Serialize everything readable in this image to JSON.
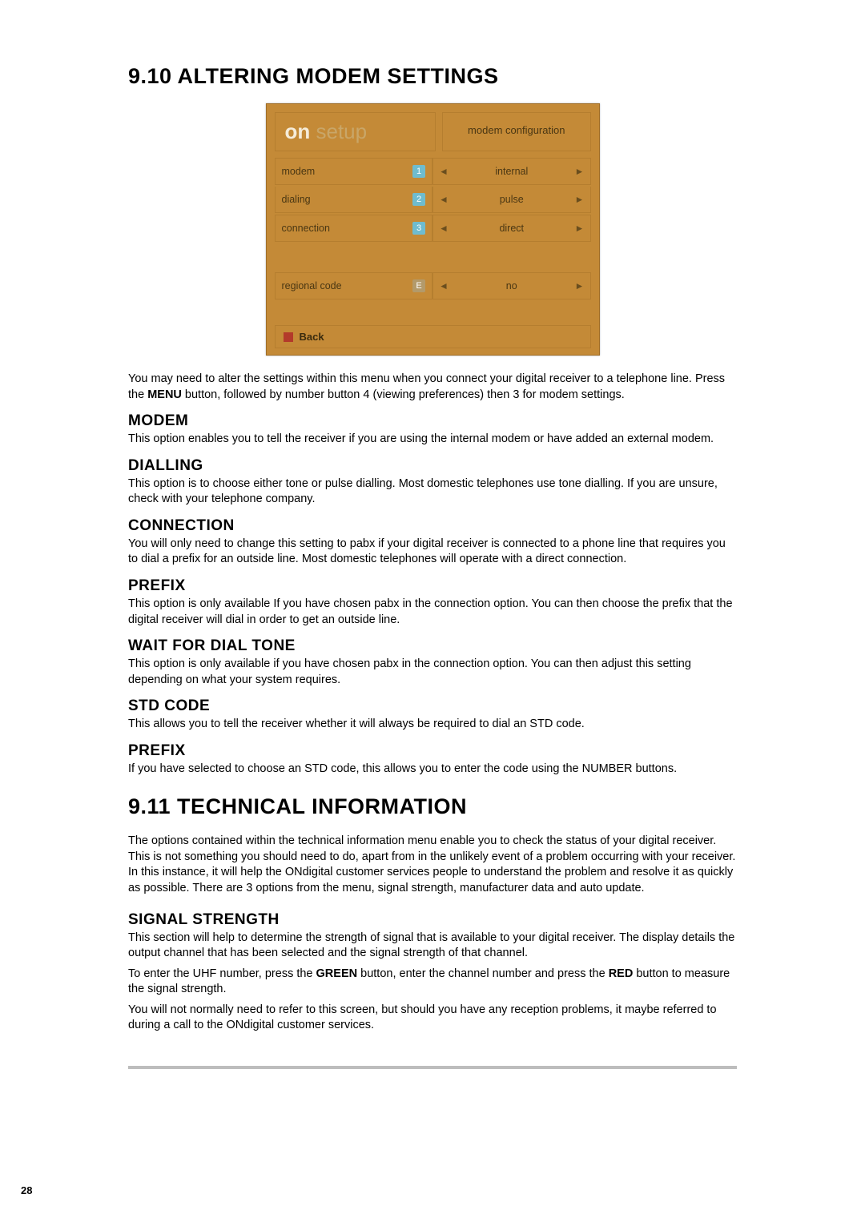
{
  "page_number": "28",
  "sections": {
    "s910": {
      "title": "9.10  ALTERING MODEM SETTINGS",
      "intro_pre": "You may need to alter the settings within this menu when you connect your digital receiver to a telephone line. Press the ",
      "intro_bold": "MENU",
      "intro_post": " button, followed by number button 4 (viewing preferences) then 3 for modem settings.",
      "subs": {
        "modem": {
          "title": "MODEM",
          "text": "This option enables you to tell the receiver if you are using the internal modem or have added an external modem."
        },
        "dialling": {
          "title": "DIALLING",
          "text": "This option is to choose either tone or pulse dialling. Most domestic telephones use tone dialling. If you are unsure, check with your telephone company."
        },
        "connection": {
          "title": "CONNECTION",
          "text": "You will only need to change this setting to pabx if your digital receiver is connected to a phone line that requires you to dial a prefix for an outside line. Most domestic telephones will operate with a direct connection."
        },
        "prefix1": {
          "title": "PREFIX",
          "text": "This option is only available If you have chosen pabx in the connection option. You can then choose the prefix that the digital receiver will dial in order to get an outside line."
        },
        "waitdial": {
          "title": "WAIT FOR DIAL TONE",
          "text": "This option is only available if you have chosen pabx in the connection option. You can then adjust this setting depending on what your system requires."
        },
        "stdcode": {
          "title": "STD CODE",
          "text": "This allows you to tell the receiver whether it will always be required to dial an STD code."
        },
        "prefix2": {
          "title": "PREFIX",
          "text": "If you have selected to choose an STD code, this allows you to enter the code using the NUMBER buttons."
        }
      }
    },
    "s911": {
      "title": "9.11  TECHNICAL INFORMATION",
      "intro": "The options contained within the technical information menu enable you to check the status of your digital receiver. This is not something you should need to do, apart from in the unlikely event of a problem occurring with your receiver. In this instance, it will help the ONdigital customer services people to understand the problem and resolve it as quickly as possible. There are 3 options from the menu, signal strength, manufacturer data and auto update.",
      "subs": {
        "signal": {
          "title": "SIGNAL STRENGTH",
          "p1": "This section will help to determine the strength of signal that is available to your digital receiver. The display details the output channel that has been selected and the signal strength of that channel.",
          "p2_pre": "To enter the UHF number, press the ",
          "p2_b1": "GREEN",
          "p2_mid": " button, enter the channel number and press the ",
          "p2_b2": "RED",
          "p2_post": " button to measure the signal strength.",
          "p3": "You will not normally need to refer to this screen, but should you have any reception problems, it maybe referred to during a call to the ONdigital customer services."
        }
      }
    }
  },
  "setup_screen": {
    "logo_on": "on",
    "logo_setup": " setup",
    "panel_title": "modem configuration",
    "left_rows": [
      {
        "label": "modem",
        "num": "1"
      },
      {
        "label": "dialing",
        "num": "2"
      },
      {
        "label": "connection",
        "num": "3"
      },
      {
        "label": "regional code",
        "num": "E"
      }
    ],
    "right_rows": [
      {
        "value": "internal"
      },
      {
        "value": "pulse"
      },
      {
        "value": "direct"
      },
      {
        "value": "no"
      }
    ],
    "footer": "Back"
  }
}
